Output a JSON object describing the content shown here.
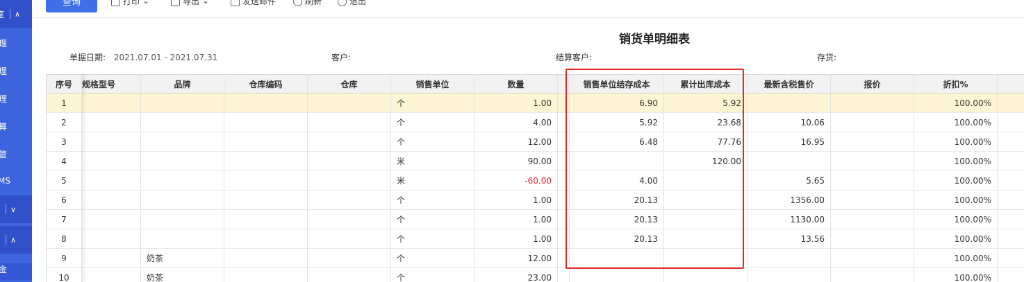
{
  "sidebar": {
    "items": [
      {
        "label": "室",
        "chevron": "∧"
      },
      {
        "label": "理"
      },
      {
        "label": "理"
      },
      {
        "label": "理"
      },
      {
        "label": "算"
      },
      {
        "label": "管"
      },
      {
        "label": "MS"
      },
      {
        "label": "",
        "chevron": "∨"
      },
      {
        "label": "",
        "chevron": "∧"
      },
      {
        "label": "金"
      }
    ]
  },
  "toolbar": {
    "query_label": "查询",
    "print_label": "打印",
    "export_label": "导出",
    "email_label": "发送邮件",
    "refresh_label": "刷新",
    "exit_label": "退出"
  },
  "report": {
    "title": "销货单明细表",
    "date_label": "单据日期:",
    "date_value": "2021.07.01 - 2021.07.31",
    "customer_label": "客户:",
    "settle_customer_label": "结算客户:",
    "inventory_label": "存货:"
  },
  "table": {
    "columns": [
      "序号",
      "规格型号",
      "品牌",
      "仓库编码",
      "仓库",
      "销售单位",
      "数量",
      "",
      "销售单位结存成本",
      "累计出库成本",
      "最新含税售价",
      "报价",
      "折扣%"
    ],
    "rows": [
      {
        "seq": "1",
        "spec": "",
        "brand": "",
        "wh_code": "",
        "wh": "",
        "unit": "个",
        "qty": "1.00",
        "cost": "6.90",
        "cum_cost": "5.92",
        "price": "",
        "quote": "",
        "discount": "100.00%"
      },
      {
        "seq": "2",
        "spec": "",
        "brand": "",
        "wh_code": "",
        "wh": "",
        "unit": "个",
        "qty": "4.00",
        "cost": "5.92",
        "cum_cost": "23.68",
        "price": "10.06",
        "quote": "",
        "discount": "100.00%"
      },
      {
        "seq": "3",
        "spec": "",
        "brand": "",
        "wh_code": "",
        "wh": "",
        "unit": "个",
        "qty": "12.00",
        "cost": "6.48",
        "cum_cost": "77.76",
        "price": "16.95",
        "quote": "",
        "discount": "100.00%"
      },
      {
        "seq": "4",
        "spec": "",
        "brand": "",
        "wh_code": "",
        "wh": "",
        "unit": "米",
        "qty": "90.00",
        "cost": "",
        "cum_cost": "120.00",
        "price": "",
        "quote": "",
        "discount": "100.00%"
      },
      {
        "seq": "5",
        "spec": "",
        "brand": "",
        "wh_code": "",
        "wh": "",
        "unit": "米",
        "qty": "-60.00",
        "cost": "4.00",
        "cum_cost": "",
        "price": "5.65",
        "quote": "",
        "discount": "100.00%"
      },
      {
        "seq": "6",
        "spec": "",
        "brand": "",
        "wh_code": "",
        "wh": "",
        "unit": "个",
        "qty": "1.00",
        "cost": "20.13",
        "cum_cost": "",
        "price": "1356.00",
        "quote": "",
        "discount": "100.00%"
      },
      {
        "seq": "7",
        "spec": "",
        "brand": "",
        "wh_code": "",
        "wh": "",
        "unit": "个",
        "qty": "1.00",
        "cost": "20.13",
        "cum_cost": "",
        "price": "1130.00",
        "quote": "",
        "discount": "100.00%"
      },
      {
        "seq": "8",
        "spec": "",
        "brand": "",
        "wh_code": "",
        "wh": "",
        "unit": "个",
        "qty": "1.00",
        "cost": "20.13",
        "cum_cost": "",
        "price": "13.56",
        "quote": "",
        "discount": "100.00%"
      },
      {
        "seq": "9",
        "spec": "",
        "brand": "奶茶",
        "wh_code": "",
        "wh": "",
        "unit": "个",
        "qty": "12.00",
        "cost": "",
        "cum_cost": "",
        "price": "",
        "quote": "",
        "discount": "100.00%"
      },
      {
        "seq": "10",
        "spec": "",
        "brand": "奶茶",
        "wh_code": "",
        "wh": "",
        "unit": "个",
        "qty": "23.00",
        "cost": "",
        "cum_cost": "",
        "price": "",
        "quote": "",
        "discount": "100.00%"
      }
    ]
  },
  "colors": {
    "sidebar": "#3d63dd",
    "primary_button": "#3d6fe8",
    "highlight_row": "#fdf5d3",
    "negative": "#e8242b",
    "annotation_box": "#e02a2a"
  }
}
